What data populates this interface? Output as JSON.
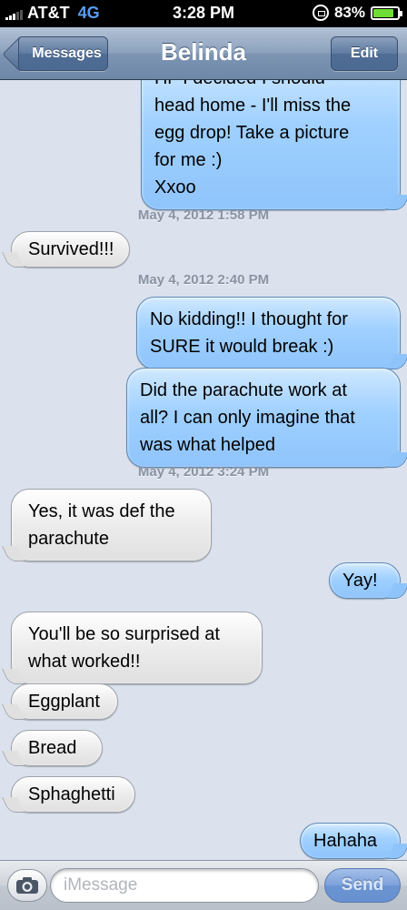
{
  "status": {
    "carrier": "AT&T",
    "network": "4G",
    "time": "3:28 PM",
    "battery": "83%",
    "battery_level": 0.83
  },
  "nav": {
    "back_label": "Messages",
    "title": "Belinda",
    "edit_label": "Edit"
  },
  "messages": [
    {
      "from": "me",
      "lines": [
        "Hi- I decided I should",
        "head home - I'll miss the",
        "egg drop! Take a picture",
        "for me :)",
        "Xxoo"
      ]
    },
    {
      "timestamp": "May 4, 2012 1:58 PM"
    },
    {
      "from": "them",
      "lines": [
        "Survived!!!"
      ]
    },
    {
      "timestamp": "May 4, 2012 2:40 PM"
    },
    {
      "from": "me",
      "lines": [
        "No kidding!! I thought for",
        "SURE it would break :)"
      ]
    },
    {
      "from": "me",
      "lines": [
        "Did the parachute work at",
        "all? I can only imagine that",
        "was what helped"
      ]
    },
    {
      "timestamp": "May 4, 2012 3:24 PM"
    },
    {
      "from": "them",
      "lines": [
        "Yes, it was def the",
        "parachute"
      ]
    },
    {
      "from": "me",
      "lines": [
        "Yay!"
      ]
    },
    {
      "from": "them",
      "lines": [
        "You'll be so surprised at",
        "what worked!!"
      ]
    },
    {
      "from": "them",
      "lines": [
        "Eggplant"
      ]
    },
    {
      "from": "them",
      "lines": [
        "Bread"
      ]
    },
    {
      "from": "them",
      "lines": [
        "Sphaghetti"
      ]
    },
    {
      "from": "me",
      "lines": [
        "Hahaha"
      ]
    }
  ],
  "compose": {
    "placeholder": "iMessage",
    "send_label": "Send"
  },
  "icons": {
    "camera": "camera-icon",
    "signal": "signal-bars-icon",
    "lock": "rotation-lock-icon",
    "battery": "battery-icon"
  },
  "colors": {
    "outgoing_bubble": "#9fd0ff",
    "incoming_bubble": "#ececec",
    "network": "#5b9cf0",
    "battery_fill": "#6fdd33",
    "nav_bar": "#8ca2bd"
  }
}
